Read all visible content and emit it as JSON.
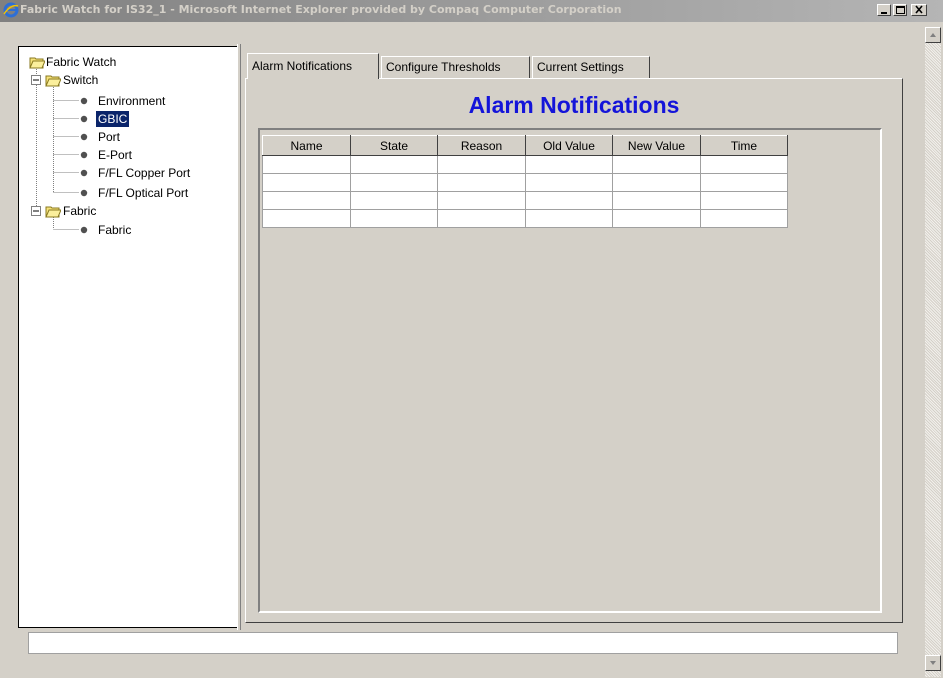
{
  "window": {
    "title": "Fabric Watch for IS32_1 - Microsoft Internet Explorer provided by Compaq Computer Corporation",
    "buttons": [
      "minimize-icon",
      "maximize-icon",
      "close-icon"
    ]
  },
  "tree": {
    "root": "Fabric Watch",
    "switch_label": "Switch",
    "switch_items": [
      "Environment",
      "GBIC",
      "Port",
      "E-Port",
      "F/FL Copper Port",
      "F/FL Optical Port"
    ],
    "selected": "GBIC",
    "fabric_label": "Fabric",
    "fabric_items": [
      "Fabric"
    ]
  },
  "tabs": [
    {
      "label": "Alarm Notifications",
      "active": true
    },
    {
      "label": "Configure Thresholds",
      "active": false
    },
    {
      "label": "Current Settings",
      "active": false
    }
  ],
  "heading": "Alarm Notifications",
  "table": {
    "columns": [
      "Name",
      "State",
      "Reason",
      "Old Value",
      "New Value",
      "Time"
    ],
    "empty_rows": 4
  },
  "status": "",
  "colors": {
    "heading": "#1414d9",
    "selection": "#0a246a",
    "chrome": "#d4d0c8"
  }
}
